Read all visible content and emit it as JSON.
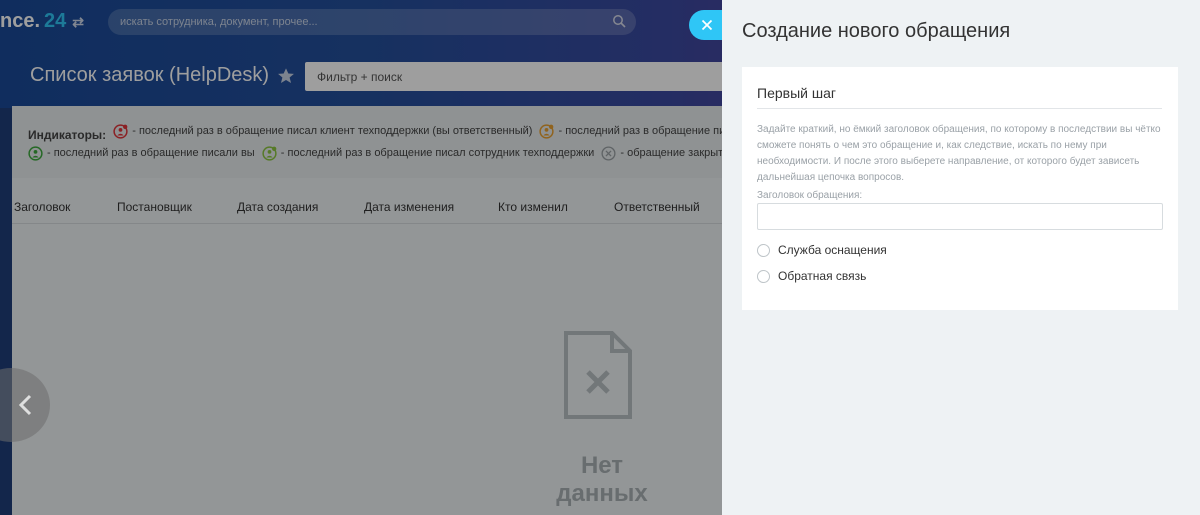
{
  "header": {
    "logo_text": "nce.",
    "logo_number": "24",
    "logo_swap": "⇄",
    "search_placeholder": "искать сотрудника, документ, прочее...",
    "page_title": "Список заявок (HelpDesk)",
    "filter_placeholder": "Фильтр + поиск"
  },
  "indicators": {
    "label": "Индикаторы:",
    "items": [
      {
        "text": "- последний раз в обращение писал клиент техподдержки (вы ответственный)",
        "color": "#e0353a"
      },
      {
        "text": "- последний раз в обращение писал",
        "color": "#e8a030"
      },
      {
        "text": "- последний раз в обращение писали вы",
        "color": "#3ca83c"
      },
      {
        "text": "- последний раз в обращение писал сотрудник техподдержки",
        "color": "#8cc63f"
      },
      {
        "text": "- обращение закрыто",
        "color": "#9aa0a4"
      }
    ]
  },
  "table": {
    "columns": [
      "Заголовок",
      "Постановщик",
      "Дата создания",
      "Дата изменения",
      "Кто изменил",
      "Ответственный"
    ],
    "empty_text": "Нет данных"
  },
  "panel": {
    "title": "Создание нового обращения",
    "step_title": "Первый шаг",
    "description": "Задайте краткий, но ёмкий заголовок обращения, по которому в последствии вы чётко сможете понять о чем это обращение и, как следствие, искать по нему при необходимости. И после этого выберете направление, от которого будет зависеть дальнейшая цепочка вопросов.",
    "field_label": "Заголовок обращения:",
    "field_value": "",
    "options": [
      "Служба оснащения",
      "Обратная связь"
    ]
  },
  "colors": {
    "accent": "#2fc6f6",
    "panel_bg": "#eef2f4"
  }
}
